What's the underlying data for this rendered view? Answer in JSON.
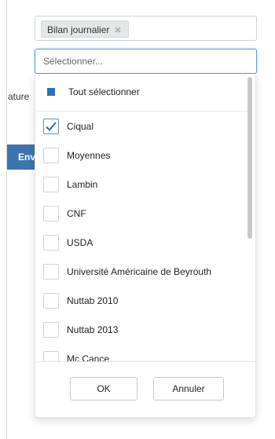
{
  "left_panel": {
    "partial_label": "ature",
    "partial_button": "Env"
  },
  "selected_tags": [
    {
      "label": "Bilan journalier",
      "remove_glyph": "✖"
    }
  ],
  "search": {
    "placeholder": "Sélectionner..."
  },
  "dropdown": {
    "select_all_label": "Tout sélectionner",
    "options": [
      {
        "label": "Ciqual",
        "checked": true
      },
      {
        "label": "Moyennes",
        "checked": false
      },
      {
        "label": "Lambin",
        "checked": false
      },
      {
        "label": "CNF",
        "checked": false
      },
      {
        "label": "USDA",
        "checked": false
      },
      {
        "label": "Université Américaine de Beyrouth",
        "checked": false
      },
      {
        "label": "Nuttab 2010",
        "checked": false
      },
      {
        "label": "Nuttab 2013",
        "checked": false
      },
      {
        "label": "Mc Cance",
        "checked": false
      }
    ],
    "ok_label": "OK",
    "cancel_label": "Annuler"
  },
  "colors": {
    "accent": "#2f6fb5",
    "button_blue": "#3a76ad",
    "focus_border": "#5b9dd9"
  }
}
